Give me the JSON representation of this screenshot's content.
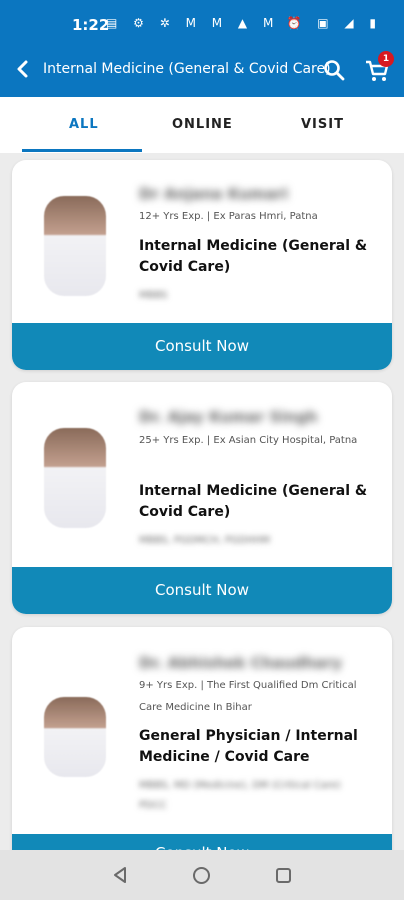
{
  "status_bar": {
    "time": "1:22",
    "left_icons": "▤ ⚙ ✲ M M ▲ M •",
    "right_icons": "⏰ ▣ ◢ ▮"
  },
  "header": {
    "title": "Internal Medicine (General & Covid Care)",
    "cart_count": "1"
  },
  "tabs": [
    {
      "label": "ALL"
    },
    {
      "label": "ONLINE"
    },
    {
      "label": "VISIT"
    }
  ],
  "doctors": [
    {
      "name": "Dr Anjana Kumari",
      "experience": "12+ Yrs Exp. | Ex Paras Hmri, Patna",
      "specialty": "Internal Medicine (General & Covid Care)",
      "qualifications": "MBBS",
      "cta": "Consult Now"
    },
    {
      "name": "Dr. Ajay Kumar Singh",
      "experience": "25+ Yrs Exp. | Ex Asian City Hospital, Patna",
      "specialty": "Internal Medicine (General & Covid Care)",
      "qualifications": "MBBS, PGDMCH, PGDHHM",
      "cta": "Consult Now"
    },
    {
      "name": "Dr. Abhishek Chaudhary",
      "experience": "9+ Yrs Exp. | The First Qualified Dm Critical Care Medicine In Bihar",
      "specialty": "General Physician / Internal Medicine / Covid Care",
      "qualifications": "MBBS, MD (Medicine), DM (Critical Care) PDCC",
      "cta": "Consult Now"
    }
  ],
  "colors": {
    "brand": "#0b76c0",
    "button": "#1189b8",
    "badge": "#d71920"
  }
}
